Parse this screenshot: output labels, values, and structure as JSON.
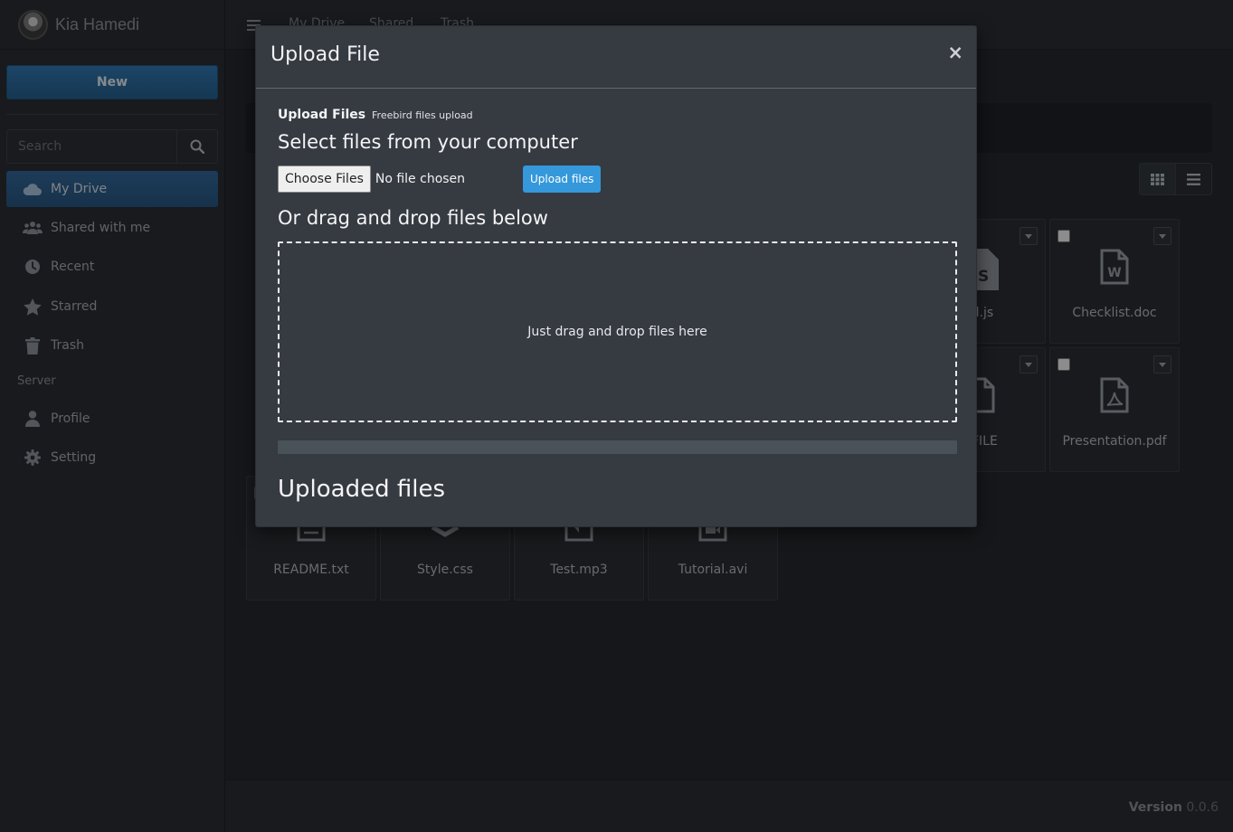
{
  "user": {
    "name": "Kia Hamedi"
  },
  "sidebar": {
    "new_label": "New",
    "search_placeholder": "Search",
    "items": [
      {
        "label": "My Drive",
        "icon": "cloud-icon",
        "active": true
      },
      {
        "label": "Shared with me",
        "icon": "users-icon"
      },
      {
        "label": "Recent",
        "icon": "clock-icon"
      },
      {
        "label": "Starred",
        "icon": "star-icon"
      },
      {
        "label": "Trash",
        "icon": "trash-icon"
      }
    ],
    "server_label": "Server",
    "server_items": [
      {
        "label": "Profile",
        "icon": "user-icon"
      },
      {
        "label": "Setting",
        "icon": "gear-icon"
      }
    ]
  },
  "topnav": {
    "items": [
      "My Drive",
      "Shared",
      "Trash"
    ]
  },
  "files": [
    {
      "name": "ld.js"
    },
    {
      "name": "Checklist.doc"
    },
    {
      "name": "EFILE"
    },
    {
      "name": "Presentation.pdf"
    },
    {
      "name": "README.txt"
    },
    {
      "name": "Style.css"
    },
    {
      "name": "Test.mp3"
    },
    {
      "name": "Tutorial.avi"
    }
  ],
  "footer": {
    "version_label": "Version",
    "version_number": "0.0.6"
  },
  "modal": {
    "title": "Upload File",
    "close": "×",
    "heading": "Upload Files",
    "heading_small": "Freebird files upload",
    "select_heading": "Select files from your computer",
    "choose_label": "Choose Files",
    "no_file": "No file chosen",
    "upload_label": "Upload files",
    "drag_heading": "Or drag and drop files below",
    "dropzone_text": "Just drag and drop files here",
    "progress": 0,
    "uploaded_heading": "Uploaded files"
  },
  "colors": {
    "accent": "#3498db",
    "active_nav": "#2c5c87",
    "modal_bg": "#363a41"
  }
}
